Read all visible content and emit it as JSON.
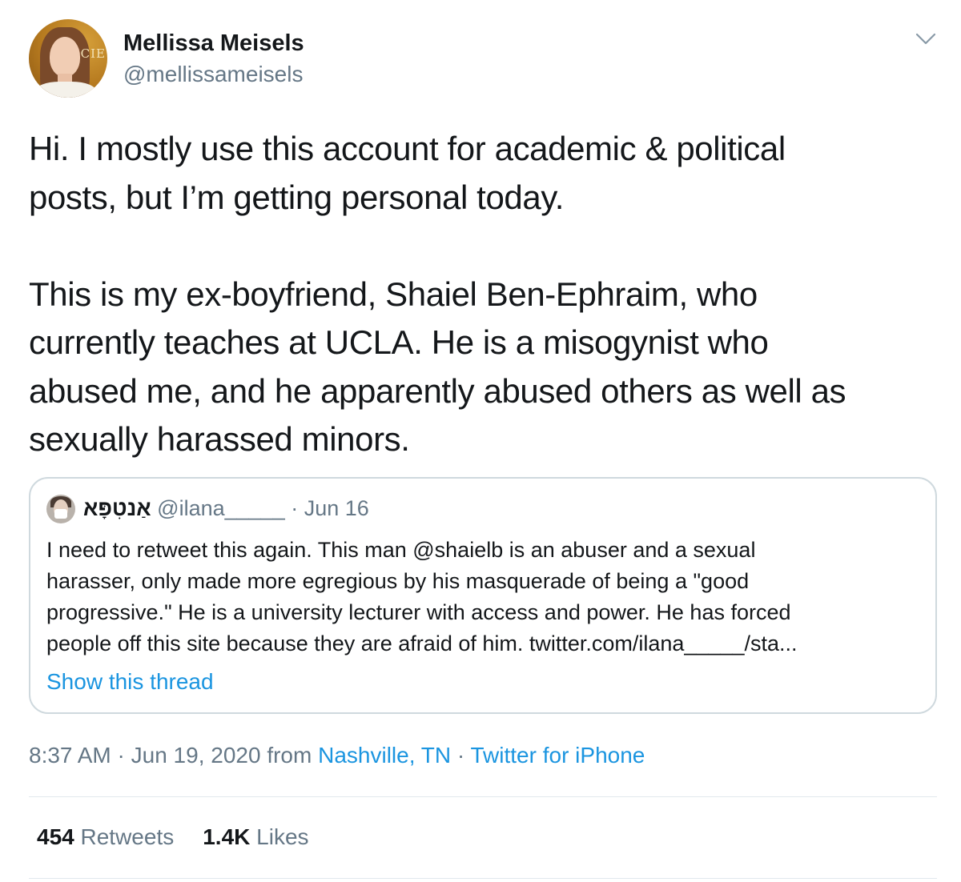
{
  "author": {
    "display_name": "Mellissa Meisels",
    "handle": "@mellissameisels",
    "avatar_sign_text": "CIE"
  },
  "tweet": {
    "paragraph1_lines": [
      "Hi. I mostly use this account for academic & political",
      "posts, but I’m getting personal today."
    ],
    "paragraph2_lines": [
      "This is my ex-boyfriend, Shaiel Ben-Ephraim, who",
      "currently teaches at UCLA. He is a misogynist who",
      "abused me, and he apparently abused others as well as",
      "sexually harassed minors."
    ]
  },
  "quoted_tweet": {
    "display_name": "אַנטִפָּא",
    "handle": "@ilana_____",
    "separator": "·",
    "date": "Jun 16",
    "body_lines": [
      "I need to retweet this again. This man @shaielb is an abuser and a sexual",
      "harasser, only made more egregious by his masquerade of being a \"good",
      "progressive.\" He is a university lecturer with access and power. He has forced",
      "people off this site because they are afraid of him. twitter.com/ilana_____/sta..."
    ],
    "show_thread_label": "Show this thread"
  },
  "meta": {
    "time": "8:37 AM",
    "sep1": "·",
    "date": "Jun 19, 2020",
    "from_label": "from",
    "location": "Nashville, TN",
    "sep2": "·",
    "source": "Twitter for iPhone"
  },
  "stats": {
    "retweets_count": "454",
    "retweets_label": "Retweets",
    "likes_count": "1.4K",
    "likes_label": "Likes"
  },
  "colors": {
    "link_blue": "#1b95e0",
    "secondary_gray": "#657786",
    "border": "#cfd9de"
  }
}
